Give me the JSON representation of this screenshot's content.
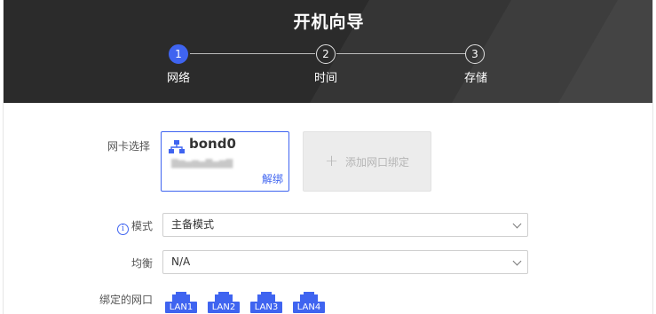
{
  "header": {
    "title": "开机向导",
    "steps": [
      {
        "num": "1",
        "label": "网络"
      },
      {
        "num": "2",
        "label": "时间"
      },
      {
        "num": "3",
        "label": "存储"
      }
    ]
  },
  "form": {
    "nic_label": "网卡选择",
    "nic_card": {
      "name": "bond0",
      "unbind": "解绑"
    },
    "add_bind": {
      "plus": "+",
      "label": "添加网口绑定"
    },
    "mode": {
      "info": "i",
      "label": "模式",
      "value": "主备模式"
    },
    "balance": {
      "label": "均衡",
      "value": "N/A"
    },
    "bound_ports": {
      "label": "绑定的网口",
      "ports": [
        "LAN1",
        "LAN2",
        "LAN3",
        "LAN4"
      ]
    }
  },
  "colors": {
    "accent": "#3f64f0",
    "header_bg": "#2b2b2b"
  }
}
